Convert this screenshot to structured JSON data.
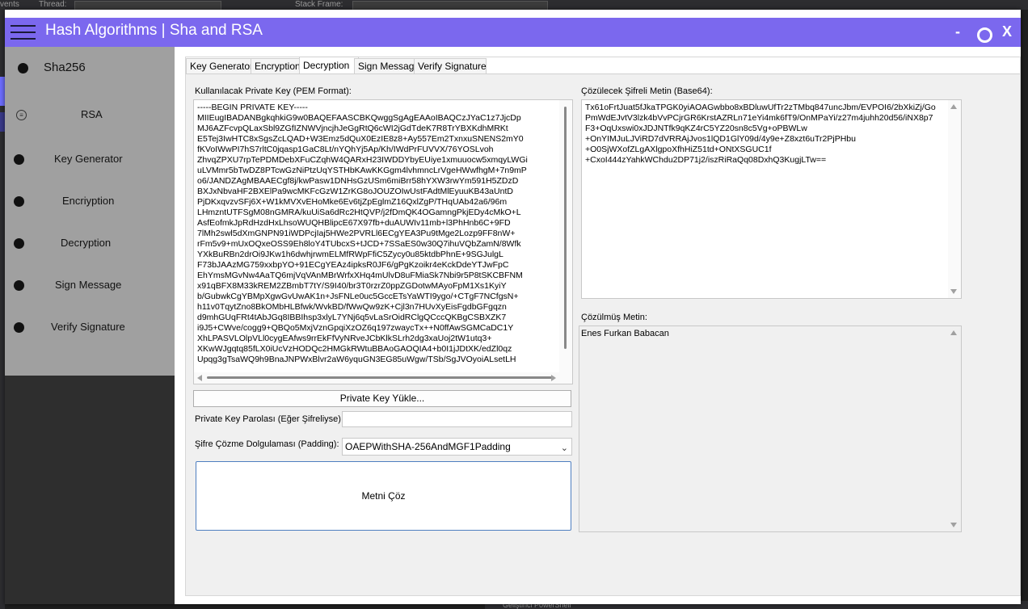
{
  "window": {
    "title": "Hash Algorithms | Sha and RSA",
    "minimize": "-",
    "close": "X"
  },
  "background_ide": {
    "events_label": "vents",
    "thread_label": "Thread:",
    "stack_frame_label": "Stack Frame:",
    "bottom_label": "Geliştirici PowerShell"
  },
  "sidebar": {
    "items": [
      {
        "label": "Sha256"
      },
      {
        "label": "RSA"
      },
      {
        "label": "Key Generator"
      },
      {
        "label": "Encriyption"
      },
      {
        "label": "Decryption"
      },
      {
        "label": "Sign Message"
      },
      {
        "label": "Verify Signature"
      }
    ]
  },
  "tabs": [
    {
      "label": "Key Generator"
    },
    {
      "label": "Encryption"
    },
    {
      "label": "Decryption"
    },
    {
      "label": "Sign Message"
    },
    {
      "label": "Verify Signature"
    }
  ],
  "active_tab": "Decryption",
  "decryption": {
    "private_key_label": "Kullanılacak Private Key (PEM Format):",
    "private_key_text": "-----BEGIN PRIVATE KEY-----\nMIIEugIBADANBgkqhkiG9w0BAQEFAASCBKQwggSgAgEAAoIBAQCzJYaC1z7JjcDp\nMJ6AZFcvpQLaxSbl9ZGfIZNWVjncjhJeGgRtQ6cWI2jGdTdeK7R8TrYBXKdhMRKt\nE5Tej3IwHTC8xSgsZcLQAD+W3Emz5dQuX0EzIE8z8+Ay557Em2TxnxuSNENS2mY0\nfKVoIWwPI7hS7rltC0jqasp1GaC8Lt/nYQhYj5Ap/Kh/IWdPrFUVVX/76YOSLvoh\nZhvqZPXU7rpTePDMDebXFuCZqhW4QARxH23IWDDYbyEUiye1xmuuocw5xmqyLWGi\nuLVMmr5bTwDZ8PTcwGzNiPtzUqYSTHbKAwKKGgm4lvhmncLrVgeHWwfhgM+7n9mP\no6/JANDZAgMBAAECgf8j/kwPasw1DNHsGzUSm6miBrr58hYXW3rwYm591H5ZDzD\nBXJxNbvaHF2BXElPa9wcMKFcGzW1ZrKG8oJOUZOIwUstFAdtMlEyuuKB43aUntD\nPjDKxqvzvSFj6X+W1kMVXvEHoMke6Ev6tjZpEglmZ16QxlZgP/THqUAb42a6/96m\nLHmzntUTFSgM08nGMRA/kuUiSa6dRc2HtQVP/j2fDmQK4OGamngPkjEDy4cMkO+L\nAsfEofmkJpRdHzdHxLhsoWUQHBlipcE67X97fb+duAUWIv11mb+l3PhHnb6C+9FD\n7lMh2swl5dXmGNPN91iWDPcjIaj5HWe2PVRLl6ECgYEA3Pu9tMge2Lozp9FF8nW+\nrFm5v9+mUxOQxeOSS9Eh8loY4TUbcxS+tJCD+7SSaES0w30Q7ihuVQbZamN/8Wfk\nYXkBuRBn2drOi9JKw1h6dwhjrwmELMfRWpFfiC5Zycy0u85ktdbPhnE+9SGJulgL\nF73bJAAzMG759xxbpYO+91ECgYEAz4ipksR0JF6/gPgKzoikr4eKckDdeYTJwFpC\nEhYmsMGvNw4AaTQ6mjVqVAnMBrWrfxXHq4mUlvD8uFMiaSk7Nbi9r5P8tSKCBFNM\nx91qBFX8M33kREM2ZBmbT7tY/S9I40/br3T0rzrZ0ppZGDotwMAyoFpM1Xs1KyiY\nb/GubwkCgYBMpXgwGvUwAK1n+JsFNLe0uc5GccETsYaWTI9ygo/+CTgF7NCfgsN+\nh11v0TqytZno8BkOMbHLBfwk/WvkBD/fWwQw9zK+Cjl3n7HUvXyEisFgdbGFgqzn\nd9mhGUqFRt4tAbJGq8IBBIhsp3xlyL7YNj6q5vLaSrOidRClgQCccQKBgCSBXZK7\ni9J5+CWve/cogg9+QBQo5MxjVznGpqiXzOZ6q197zwaycTx++N0ffAwSGMCaDC1Y\nXhLPASVLOlpVLl0cygEAfws9rrEkFfVyNRveJCbKlkSLrh2dg3xaUoj2tW1utq3+\nXKwWJgqtq85fLX0iUcVzHODQc2HMGkRWtuBBAoGAOQIA4+b0I1jJDtXK/edZl0qz\nUpqg3gTsaWQ9h9BnaJNPWxBlvr2aW6yquGN3EG85uWgw/TSb/SgJVOyoiALsetLH",
    "load_key_button": "Private Key Yükle...",
    "password_label": "Private Key Parolası (Eğer Şifreliyse):",
    "password_value": "",
    "padding_label": "Şifre Çözme Dolgulaması (Padding):",
    "padding_value": "OAEPWithSHA-256AndMGF1Padding",
    "decrypt_button": "Metni Çöz",
    "cipher_label": "Çözülecek Şifreli Metin (Base64):",
    "cipher_text": "Tx61oFrtJuat5fJkaTPGK0yiAOAGwbbo8xBDluwUfTr2zTMbq847uncJbm/EVPOI6/2bXkiZj/Go\nPmWdEJvtV3lzk4bVvPCjrGR6KrstAZRLn71eYi4mk6fT9/OnMPaYi/z27m4juhh20d56/iNX8p7\nF3+OqUxswi0xJDJNTfk9qKZ4rC5YZ20sn8c5Vg+oPBWLw\n+OnYIMJuLJViRD7dVRRAjJvos1lQD1GlY09d/4y9e+Z8xzt6uTr2PjPHbu\n+O0SjWXofZLgAXlgpoXfhHiZ51td+ONtXSGUC1f\n+CxoI444zYahkWChdu2DP71j2/iszRiRaQq08DxhQ3KugjLTw==",
    "result_label": "Çözülmüş Metin:",
    "result_text": "Enes Furkan Babacan"
  }
}
